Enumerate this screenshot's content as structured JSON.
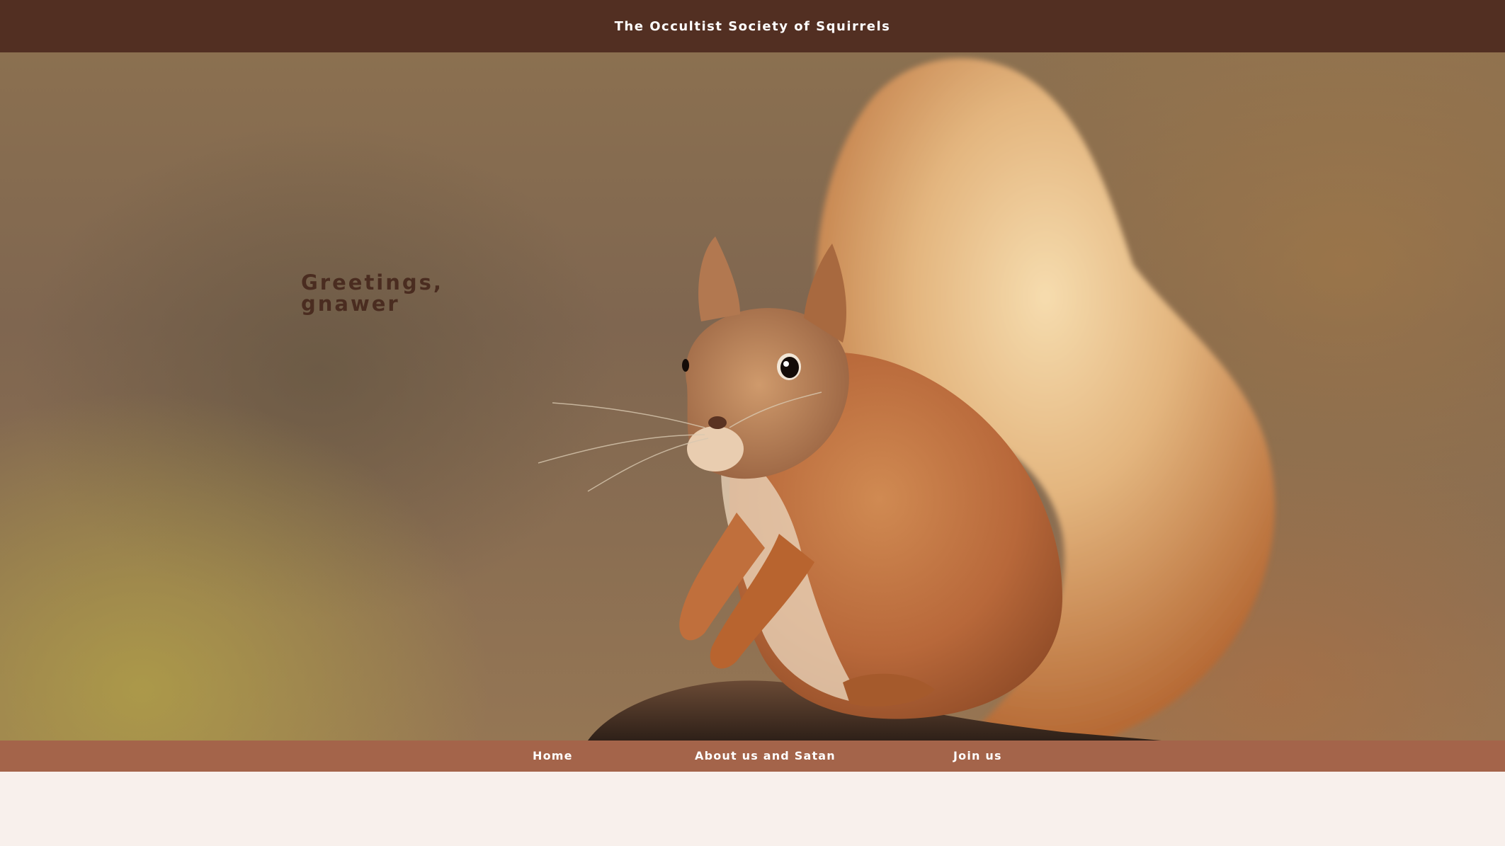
{
  "header": {
    "site_title": "The Occultist Society of Squirrels"
  },
  "hero": {
    "greeting_line1": "Greetings,",
    "greeting_line2": "gnawer",
    "image_subject": "red-squirrel-photo"
  },
  "nav": {
    "items": [
      {
        "label": "Home"
      },
      {
        "label": "About us and Satan"
      },
      {
        "label": "Join us"
      }
    ]
  },
  "colors": {
    "top_bar": "#522f22",
    "nav_bar": "#a4644a",
    "page_background": "#f8f0ec",
    "greeting_text": "#4a2c20"
  }
}
